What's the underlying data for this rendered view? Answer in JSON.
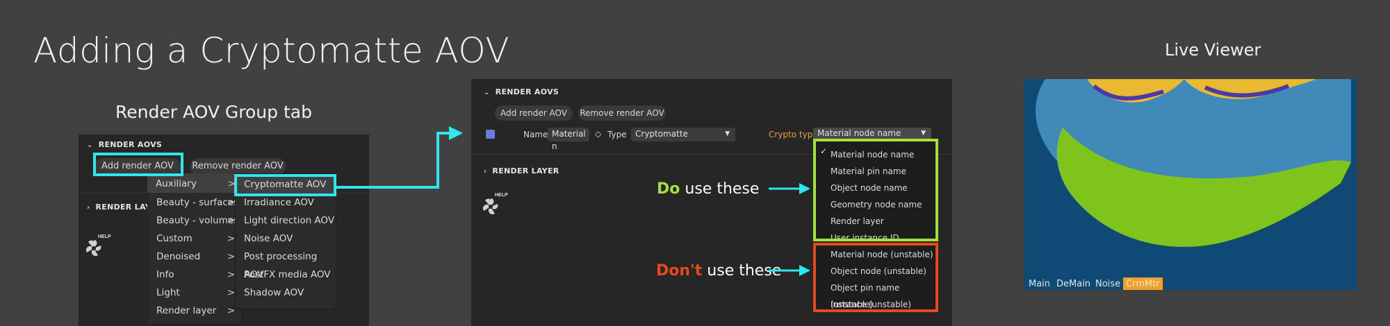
{
  "slide_title": "Adding a Cryptomatte AOV",
  "left_subtitle": "Render AOV Group tab",
  "live_viewer_title": "Live Viewer",
  "left_panel": {
    "section": "RENDER AOVS",
    "add_btn": "Add render AOV",
    "remove_btn": "Remove render AOV",
    "render_layer": "RENDER LAYER",
    "help": "HELP",
    "menu_items": [
      {
        "label": "Auxiliary",
        "arrow": ">"
      },
      {
        "label": "Beauty - surfaces",
        "arrow": ">"
      },
      {
        "label": "Beauty - volumes",
        "arrow": ">"
      },
      {
        "label": "Custom",
        "arrow": ">"
      },
      {
        "label": "Denoised",
        "arrow": ">"
      },
      {
        "label": "Info",
        "arrow": ">"
      },
      {
        "label": "Light",
        "arrow": ">"
      },
      {
        "label": "Render layer",
        "arrow": ">"
      }
    ],
    "submenu_items": [
      "Cryptomatte AOV",
      "Irradiance AOV",
      "Light direction AOV",
      "Noise AOV",
      "Post processing AOV",
      "PostFX media AOV",
      "Shadow AOV"
    ]
  },
  "middle_panel": {
    "section": "RENDER AOVS",
    "add_btn": "Add render AOV",
    "remove_btn": "Remove render AOV",
    "name_label": "Name",
    "name_value": "Material n",
    "type_label": "Type",
    "type_value": "Cryptomatte",
    "crypto_label": "Crypto type",
    "crypto_value": "Material node name",
    "render_layer": "RENDER LAYER",
    "help": "HELP",
    "checkmark": "✓",
    "good_items": [
      "Material node name",
      "Material pin name",
      "Object node name",
      "Geometry node name",
      "Render layer",
      "User instance ID"
    ],
    "bad_items": [
      "Material node (unstable)",
      "Object node (unstable)",
      "Object pin name (unstable)",
      "Instance (unstable)"
    ],
    "do_word": "Do",
    "do_rest": " use these",
    "dont_word": "Don't",
    "dont_rest": " use these"
  },
  "viewer": {
    "tabs": [
      "Main",
      "DeMain",
      "Noise",
      "CrmMtr"
    ]
  },
  "colors": {
    "cyan": "#2ee6ec",
    "green": "#a4e23a",
    "red": "#e44a1b",
    "crypto_label": "#f0a030"
  }
}
